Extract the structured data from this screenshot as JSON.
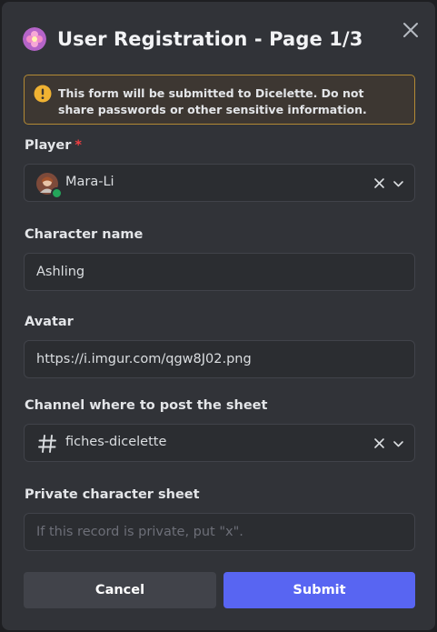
{
  "modal": {
    "title": "User Registration - Page 1/3",
    "app_icon": "flower-app-icon",
    "close_icon": "close-icon"
  },
  "warning": {
    "text": "This form will be submitted to Dicelette. Do not share passwords or other sensitive information.",
    "icon": "warning-icon",
    "accent_color": "#f0b232"
  },
  "fields": {
    "player": {
      "label": "Player",
      "required_marker": "*",
      "value": "Mara-Li",
      "status_color": "#23a55a"
    },
    "character_name": {
      "label": "Character name",
      "value": "Ashling"
    },
    "avatar": {
      "label": "Avatar",
      "value": "https://i.imgur.com/qgw8J02.png"
    },
    "channel": {
      "label": "Channel where to post the sheet",
      "value": "fiches-dicelette",
      "icon": "hash-icon"
    },
    "private_sheet": {
      "label": "Private character sheet",
      "placeholder": "If this record is private, put \"x\"."
    }
  },
  "buttons": {
    "cancel_label": "Cancel",
    "submit_label": "Submit",
    "submit_color": "#5865f2"
  }
}
